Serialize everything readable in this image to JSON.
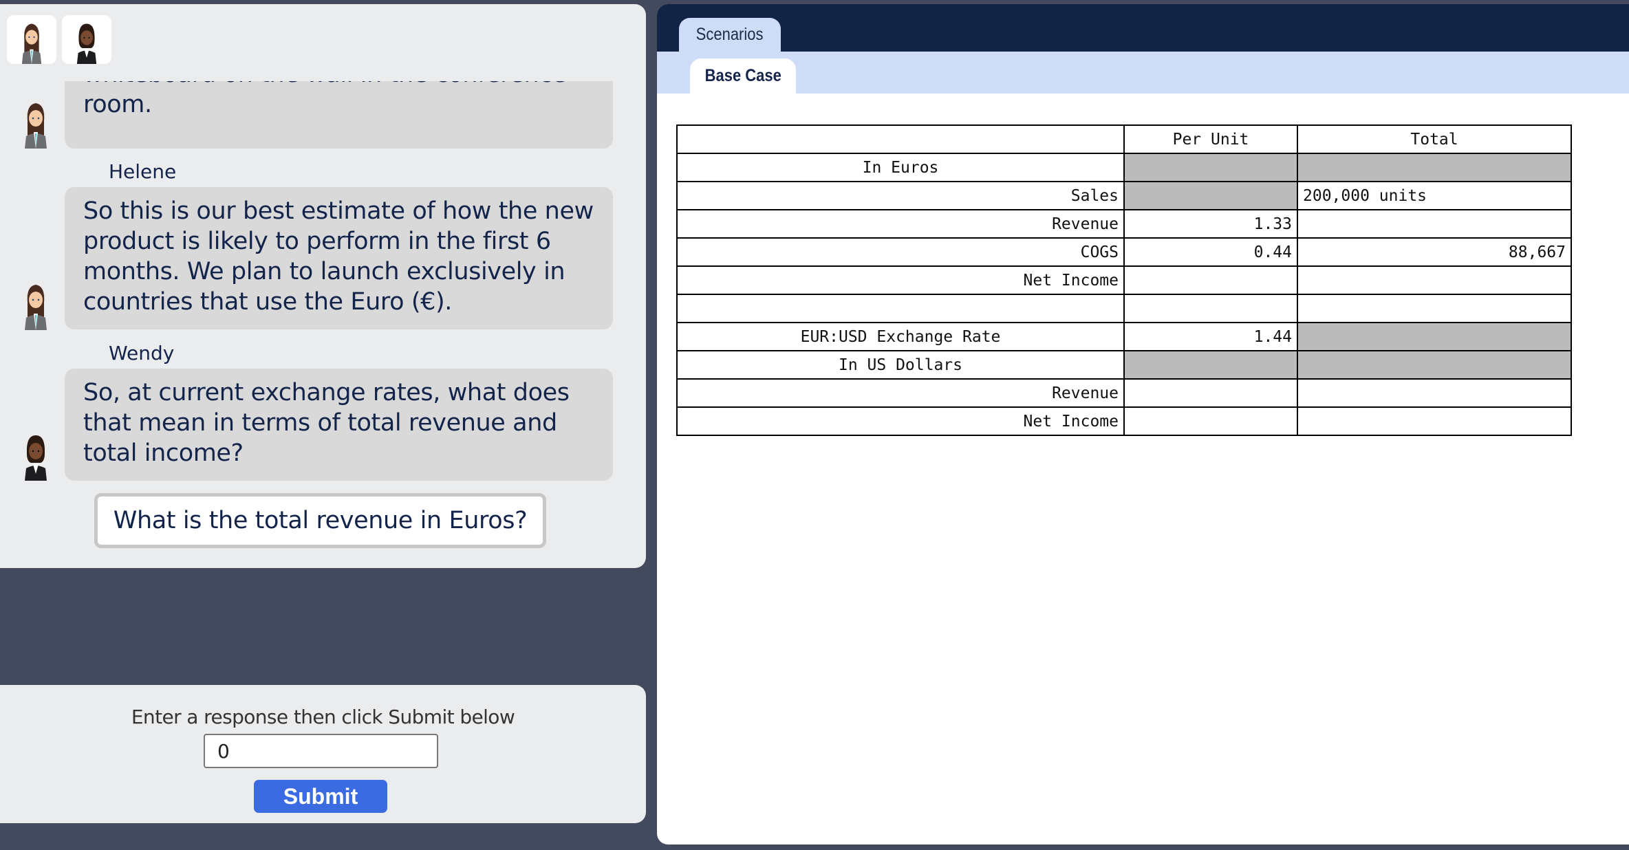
{
  "participants": [
    {
      "name": "Helene",
      "avatar": "helene-avatar"
    },
    {
      "name": "Wendy",
      "avatar": "wendy-avatar"
    }
  ],
  "chat": {
    "messages": [
      {
        "speaker": "Helene",
        "show_name": false,
        "text": "whiteboard on the wall in the conference room."
      },
      {
        "speaker": "Helene",
        "show_name": true,
        "text": "So this is our best estimate of how the new product is likely to perform in the first 6 months. We plan to launch exclusively in countries that use the Euro (€)."
      },
      {
        "speaker": "Wendy",
        "show_name": true,
        "text": "So, at current exchange rates, what does that mean in terms of total revenue and total income?"
      }
    ],
    "option": "What is the total revenue in Euros?"
  },
  "response": {
    "label": "Enter a response then click Submit below",
    "value": "0",
    "submit_label": "Submit"
  },
  "tabs": {
    "primary": "Scenarios",
    "secondary": "Base Case"
  },
  "table": {
    "headers": [
      "",
      "Per Unit",
      "Total"
    ],
    "rows": [
      {
        "label": "In Euros",
        "section": true,
        "per_unit": "",
        "total": "",
        "per_unit_gray": true,
        "total_gray": true
      },
      {
        "label": "Sales",
        "per_unit": "",
        "total": "200,000 units",
        "per_unit_gray": true
      },
      {
        "label": "Revenue",
        "per_unit": "1.33",
        "total": ""
      },
      {
        "label": "COGS",
        "per_unit": "0.44",
        "total": "88,667",
        "total_right": true
      },
      {
        "label": "Net Income",
        "per_unit": "",
        "total": ""
      },
      {
        "label": "",
        "per_unit": "",
        "total": ""
      },
      {
        "label": "EUR:USD Exchange Rate",
        "section": true,
        "per_unit": "1.44",
        "total": "",
        "total_gray": true
      },
      {
        "label": "In US Dollars",
        "section": true,
        "per_unit": "",
        "total": "",
        "per_unit_gray": true,
        "total_gray": true
      },
      {
        "label": "Revenue",
        "per_unit": "",
        "total": ""
      },
      {
        "label": "Net Income",
        "per_unit": "",
        "total": ""
      }
    ]
  },
  "colors": {
    "page_bg": "#434a5e",
    "header_dark": "#112445",
    "tab_band": "#cfdcf7",
    "bubble": "#d9d9da",
    "submit": "#3b6be0",
    "locked_cell": "#bbbbbb"
  }
}
